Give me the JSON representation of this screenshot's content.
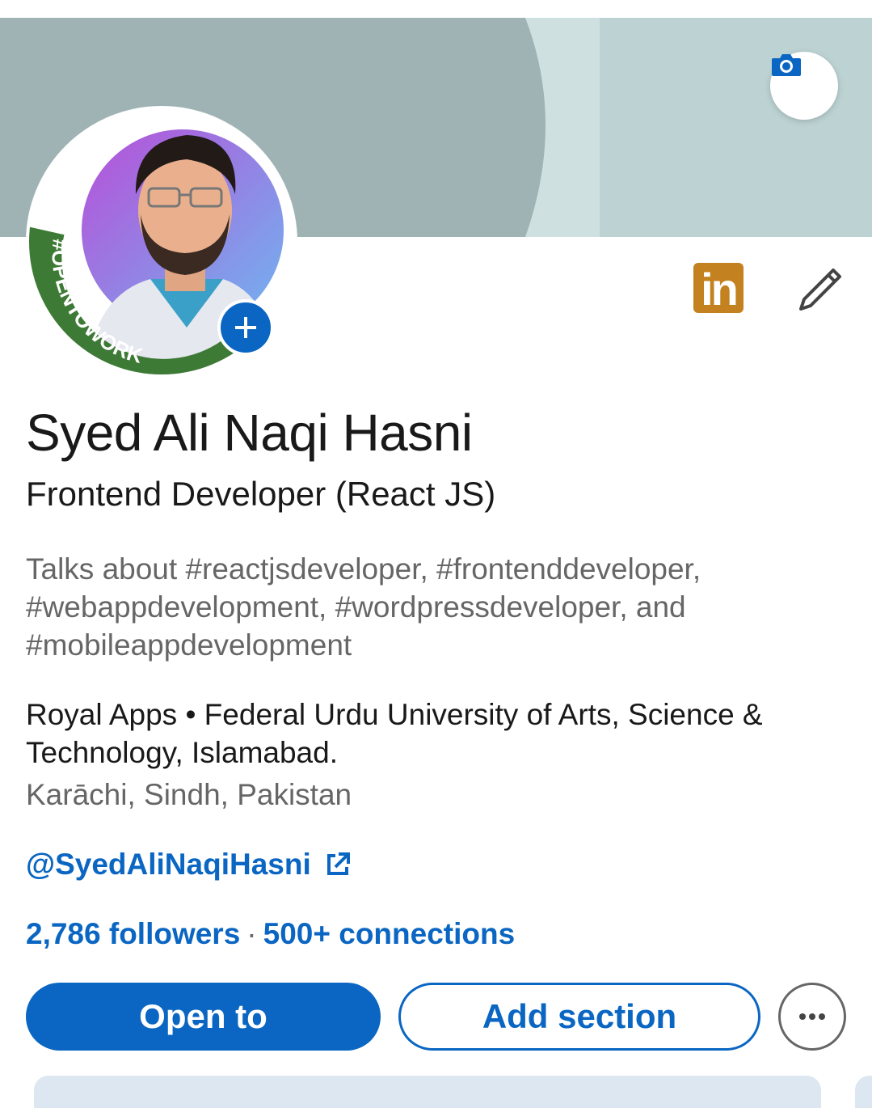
{
  "profile": {
    "name": "Syed Ali Naqi Hasni",
    "headline": "Frontend Developer (React JS)",
    "talks_about": "Talks about #reactjsdeveloper, #frontenddeveloper, #webappdevelopment, #wordpressdeveloper, and #mobileappdevelopment",
    "education_line": "Royal Apps • Federal Urdu University of Arts, Science & Technology, Islamabad.",
    "location": "Karāchi, Sindh, Pakistan",
    "website": "@SyedAliNaqiHasni",
    "followers": "2,786 followers",
    "separator": "·",
    "connections": "500+ connections",
    "frame_text": "#OPENTOWORK"
  },
  "badges": {
    "linkedin_icon_text": "in"
  },
  "actions": {
    "open_to": "Open to",
    "add_section": "Add section"
  },
  "icons": {
    "banner_edit": "camera-icon",
    "add_photo": "plus-icon",
    "linkedin": "linkedin-logo-icon",
    "edit": "pencil-icon",
    "external": "external-link-icon",
    "more": "more-dots-icon"
  },
  "colors": {
    "accent": "#0a66c2",
    "opentowork_frame": "#3d7a35",
    "linkedin_badge": "#c3811f",
    "banner": "#9fb3b5"
  }
}
